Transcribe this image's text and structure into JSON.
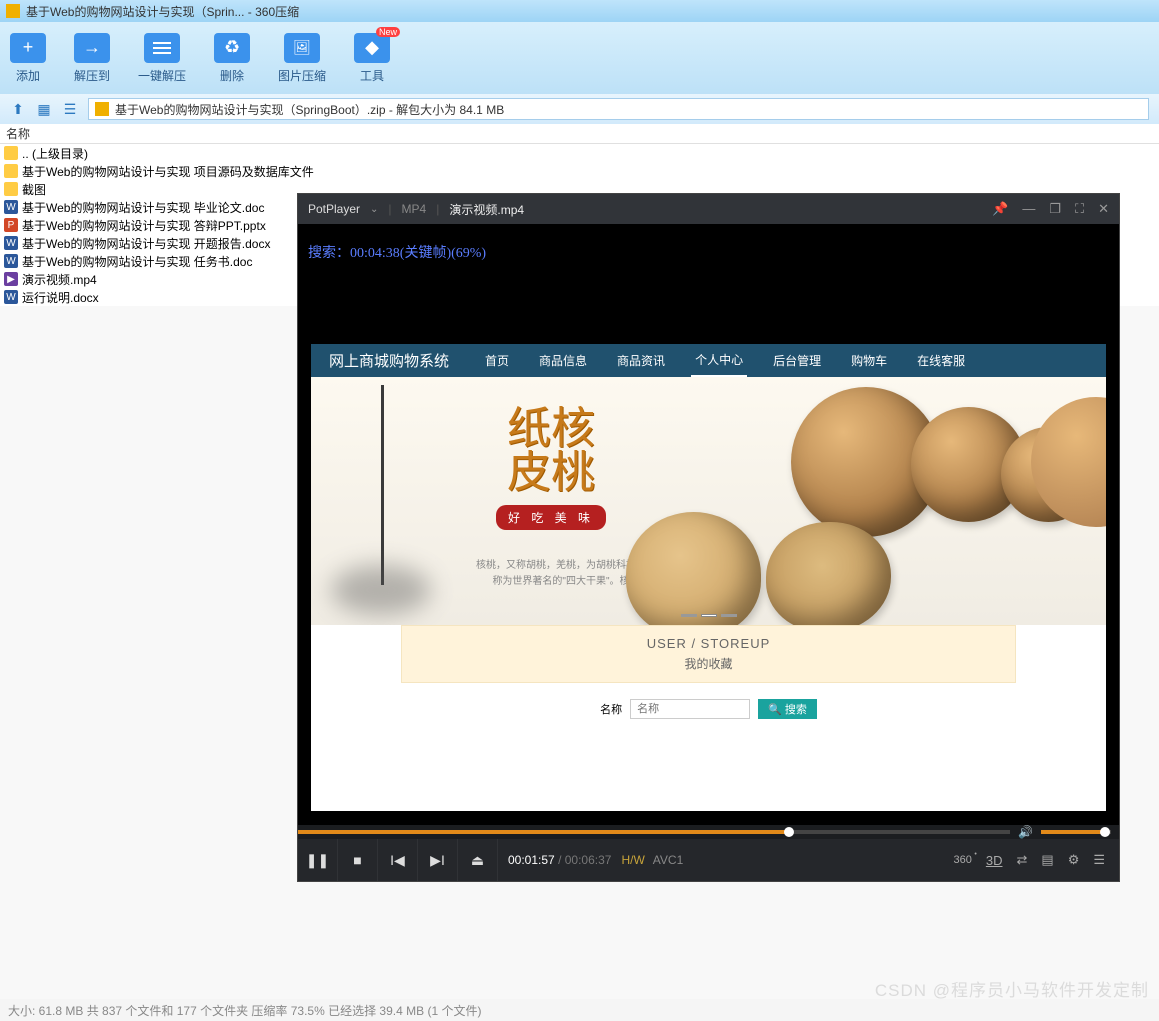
{
  "window": {
    "title": "基于Web的购物网站设计与实现（Sprin... - 360压缩"
  },
  "toolbar": {
    "add": "添加",
    "extract_to": "解压到",
    "one_key": "一键解压",
    "delete": "删除",
    "image_compress": "图片压缩",
    "tools": "工具",
    "new_badge": "New"
  },
  "path": {
    "text": "基于Web的购物网站设计与实现（SpringBoot）.zip - 解包大小为 84.1 MB"
  },
  "columns": {
    "name": "名称"
  },
  "files": [
    {
      "icon": "folder",
      "name": ".. (上级目录)"
    },
    {
      "icon": "folder",
      "name": "基于Web的购物网站设计与实现 项目源码及数据库文件"
    },
    {
      "icon": "folder",
      "name": "截图"
    },
    {
      "icon": "w",
      "name": "基于Web的购物网站设计与实现 毕业论文.doc"
    },
    {
      "icon": "p",
      "name": "基于Web的购物网站设计与实现 答辩PPT.pptx"
    },
    {
      "icon": "w",
      "name": "基于Web的购物网站设计与实现 开题报告.docx"
    },
    {
      "icon": "w",
      "name": "基于Web的购物网站设计与实现 任务书.doc"
    },
    {
      "icon": "mp4",
      "name": "演示视频.mp4"
    },
    {
      "icon": "w",
      "name": "运行说明.docx"
    }
  ],
  "potplayer": {
    "appname": "PotPlayer",
    "format": "MP4",
    "filename": "演示视频.mp4",
    "search_overlay": "搜索：00:04:38(关键帧)(69%)",
    "time": {
      "current": "00:01:57",
      "duration": "00:06:37"
    },
    "hw": "H/W",
    "codec": "AVC1",
    "r360": "360",
    "r3d": "3D"
  },
  "web": {
    "brand": "网上商城购物系统",
    "nav": [
      "首页",
      "商品信息",
      "商品资讯",
      "个人中心",
      "后台管理",
      "购物车",
      "在线客服"
    ],
    "active_index": 3,
    "banner_chars": "纸核\n皮桃",
    "banner_sub": "好 吃 美 味",
    "banner_desc1": "核桃，又称胡桃，羌桃，为胡桃科植物。与扁桃、腰果、榛子并",
    "banner_desc2": "称为世界著名的\"四大干果\"。核桃仁含有丰富的营养素，",
    "storeup_en": "USER / STOREUP",
    "storeup_zh": "我的收藏",
    "search_label": "名称",
    "search_placeholder": "名称",
    "search_btn": "搜索"
  },
  "statusbar": {
    "text": "大小: 61.8 MB 共 837 个文件和 177 个文件夹 压缩率 73.5% 已经选择 39.4 MB (1 个文件)"
  },
  "watermark": "CSDN @程序员小马软件开发定制"
}
